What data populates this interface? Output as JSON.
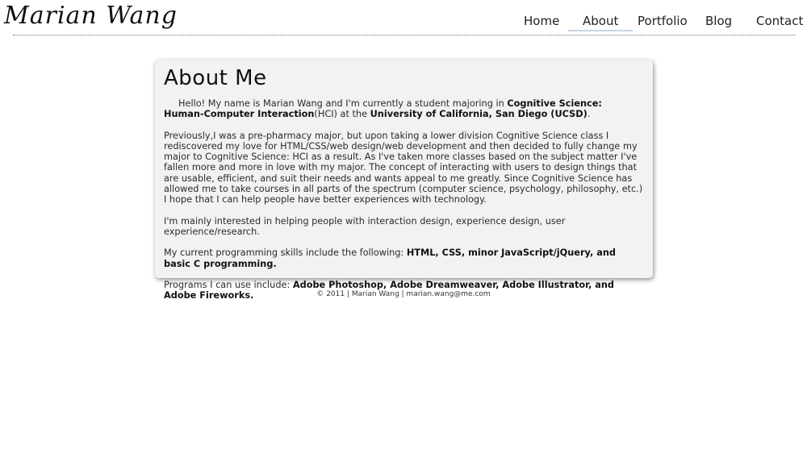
{
  "header": {
    "logo": "Marian Wang",
    "nav": [
      {
        "label": "Home"
      },
      {
        "label": "About"
      },
      {
        "label": "Portfolio"
      },
      {
        "label": "Blog"
      },
      {
        "label": "Contact"
      }
    ],
    "active_nav": "About",
    "active_underline_color": "#c7d6e6"
  },
  "about": {
    "heading": "About Me",
    "p1_a": "Hello! My name is Marian Wang and I'm currently a student majoring in ",
    "p1_b": "Cognitive Science: Human-Computer Interaction",
    "p1_c": "(HCI) at the ",
    "p1_d": "University of California, San Diego (UCSD)",
    "p1_e": ".",
    "p2": "Previously,I was a pre-pharmacy major, but upon taking a lower division Cognitive Science class I rediscovered my love for HTML/CSS/web design/web development and then decided to fully change my major to Cognitive Science: HCI as a result. As I've taken more classes based on the subject matter I've fallen more and more in love with my major. The concept of interacting with users to design things that are usable, efficient, and suit their needs and wants appeal to me greatly. Since Cognitive Science has allowed me to take courses in all parts of the spectrum (computer science, psychology, philosophy, etc.) I hope that I can help people have better experiences with technology.",
    "p3": "I'm mainly interested in helping people with interaction design, experience design, user experience/research.",
    "p4_a": "My current programming skills include the following: ",
    "p4_b": "HTML, CSS, minor JavaScript/jQuery, and basic C programming.",
    "p5_a": "Programs I can use include: ",
    "p5_b": "Adobe Photoshop, Adobe Dreamweaver, Adobe Illustrator, and Adobe Fireworks."
  },
  "footer": {
    "text": "© 2011 | Marian Wang | ",
    "email": "marian.wang@me.com"
  }
}
